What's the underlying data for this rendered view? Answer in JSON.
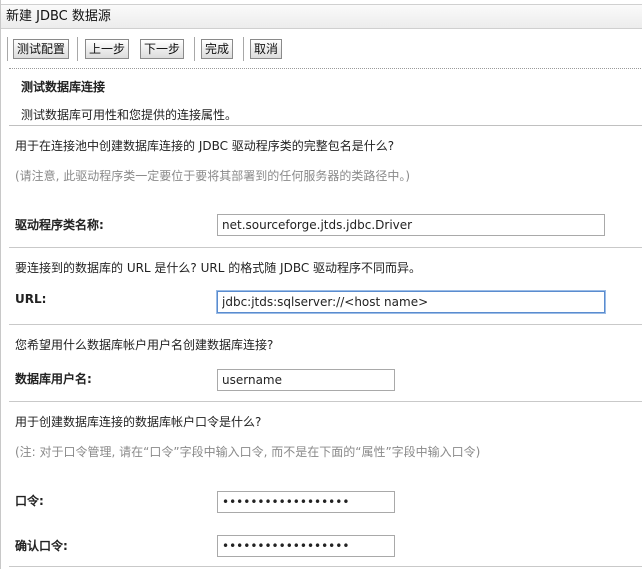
{
  "window": {
    "title": "新建 JDBC 数据源"
  },
  "toolbar": {
    "test_config_label": "测试配置",
    "previous_label": "上一步",
    "next_label": "下一步",
    "finish_label": "完成",
    "cancel_label": "取消"
  },
  "section": {
    "heading": "测试数据库连接",
    "description": "测试数据库可用性和您提供的连接属性。"
  },
  "driver": {
    "question": "用于在连接池中创建数据库连接的 JDBC 驱动程序类的完整包名是什么?",
    "note": "(请注意, 此驱动程序类一定要位于要将其部署到的任何服务器的类路径中。)",
    "label": "驱动程序类名称:",
    "value": "net.sourceforge.jtds.jdbc.Driver"
  },
  "url": {
    "question": "要连接到的数据库的 URL 是什么? URL 的格式随 JDBC 驱动程序不同而异。",
    "label": "URL:",
    "value": "jdbc:jtds:sqlserver://<host name>"
  },
  "username": {
    "question": "您希望用什么数据库帐户用户名创建数据库连接?",
    "label": "数据库用户名:",
    "value": "username"
  },
  "password": {
    "question": "用于创建数据库连接的数据库帐户口令是什么?",
    "note": "(注: 对于口令管理, 请在“口令”字段中输入口令, 而不是在下面的“属性”字段中输入口令)",
    "label": "口令:",
    "value": "••••••••••••••••••",
    "confirm_label": "确认口令:",
    "confirm_value": "••••••••••••••••••"
  }
}
